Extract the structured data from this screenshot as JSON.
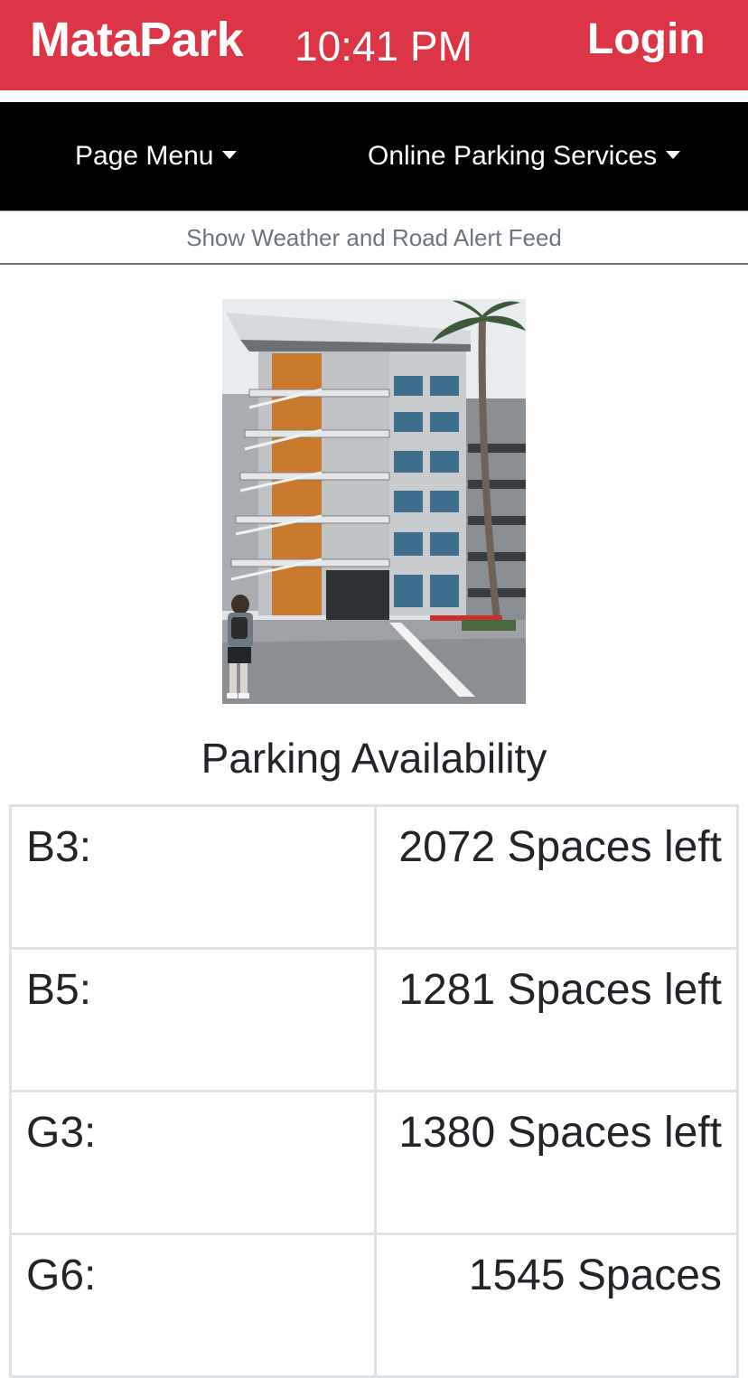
{
  "header": {
    "brand": "MataPark",
    "time": "10:41 PM",
    "login_label": "Login"
  },
  "nav": {
    "page_menu_label": "Page Menu",
    "online_services_label": "Online Parking Services"
  },
  "alert_toggle_label": "Show Weather and Road Alert Feed",
  "availability": {
    "title": "Parking Availability",
    "rows": [
      {
        "lot": "B3:",
        "spaces": "2072 Spaces left"
      },
      {
        "lot": "B5:",
        "spaces": "1281 Spaces left"
      },
      {
        "lot": "G3:",
        "spaces": "1380 Spaces left"
      },
      {
        "lot": "G6:",
        "spaces": "1545 Spaces"
      }
    ]
  },
  "colors": {
    "brand_red": "#dc3545",
    "nav_black": "#000000",
    "muted_text": "#6c757d"
  }
}
